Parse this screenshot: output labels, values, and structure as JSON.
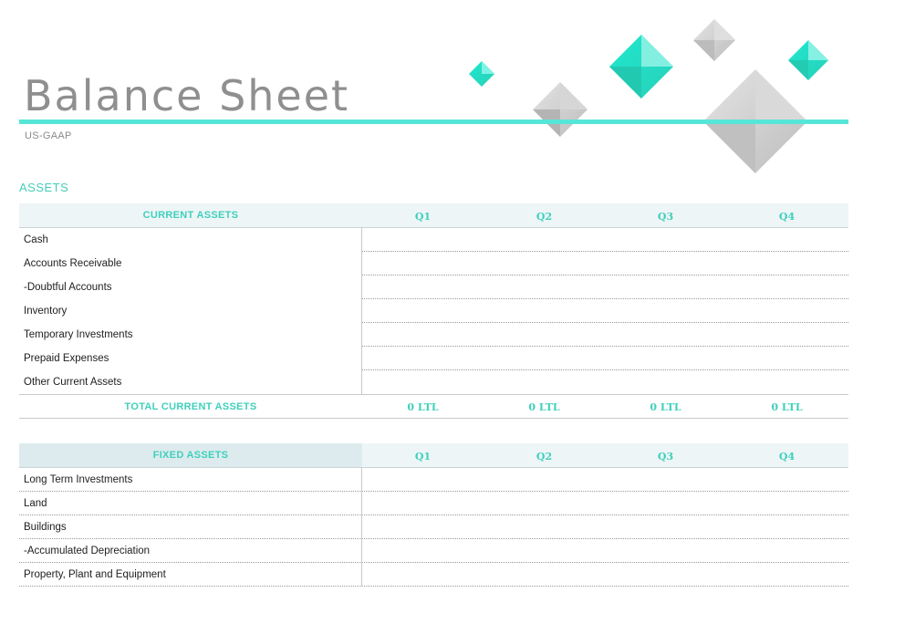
{
  "document": {
    "title": "Balance Sheet",
    "subtitle": "US-GAAP",
    "section_label": "ASSETS",
    "accent_color": "#56e6d8",
    "header_text_color": "#3fd0bc"
  },
  "decoration": {
    "icon": "diamond-gems-cluster",
    "colors": [
      "#1fe3c9",
      "#c6c6c6"
    ]
  },
  "current_assets": {
    "header": "CURRENT ASSETS",
    "quarters": [
      "Q1",
      "Q2",
      "Q3",
      "Q4"
    ],
    "rows": [
      "Cash",
      "Accounts Receivable",
      "-Doubtful Accounts",
      "Inventory",
      "Temporary Investments",
      "Prepaid Expenses",
      "Other Current Assets"
    ],
    "total_label": "TOTAL CURRENT ASSETS",
    "totals": [
      "0 LTL",
      "0 LTL",
      "0 LTL",
      "0 LTL"
    ]
  },
  "fixed_assets": {
    "header": "FIXED ASSETS",
    "quarters": [
      "Q1",
      "Q2",
      "Q3",
      "Q4"
    ],
    "rows": [
      "Long Term Investments",
      "Land",
      "Buildings",
      "-Accumulated Depreciation",
      "Property, Plant and Equipment"
    ]
  }
}
